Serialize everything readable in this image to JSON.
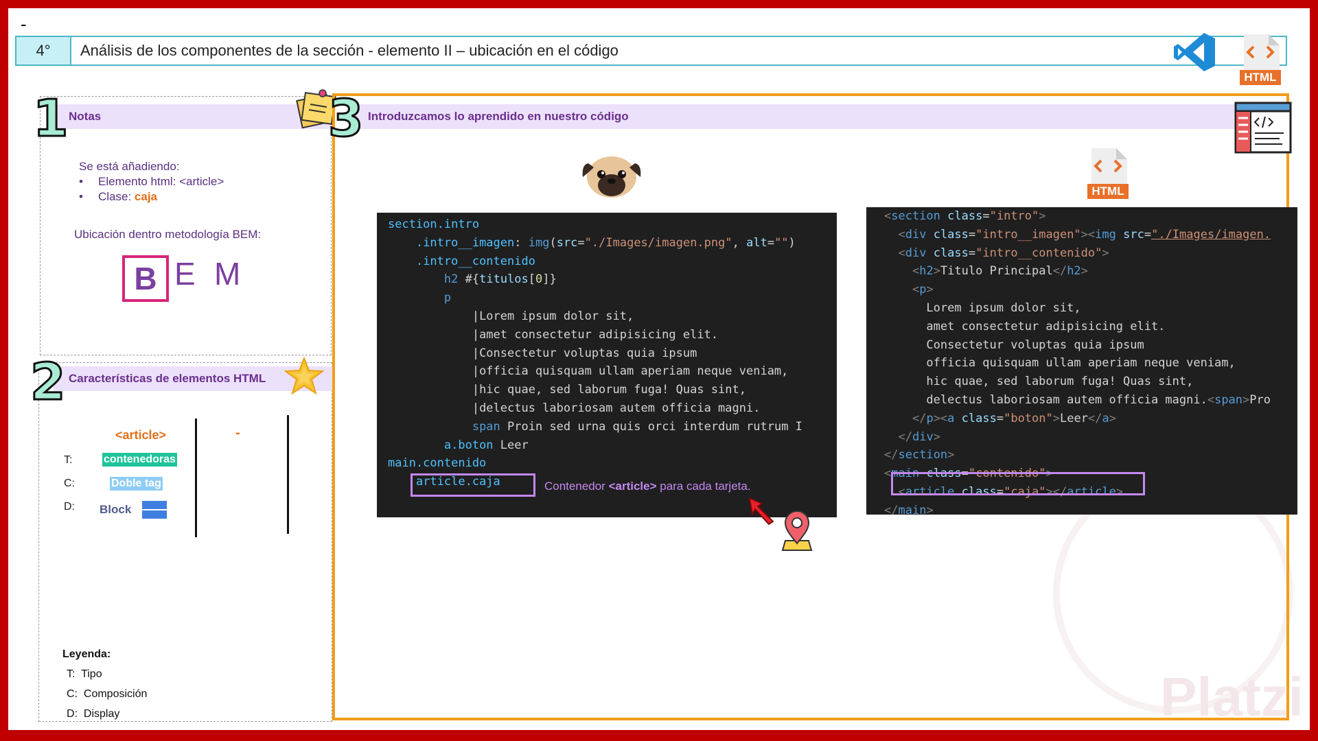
{
  "top_mark": "-",
  "header": {
    "number": "4°",
    "title": "Análisis de los componentes de la sección   - elemento II – ubicación en el código",
    "html_icon_label": "HTML"
  },
  "notes": {
    "step": "1",
    "title": "Notas",
    "intro": "Se está añadiendo:",
    "item1": "Elemento html: <article>",
    "item2_prefix": "Clase: ",
    "item2_value": "caja",
    "bem_label": "Ubicación dentro metodología BEM:",
    "bem_b": "B",
    "bem_e": "E",
    "bem_m": "M"
  },
  "characteristics": {
    "step": "2",
    "title": "Características de elementos HTML",
    "tag": "<article>",
    "other": "-",
    "rows": [
      {
        "key": "T:",
        "value": "contenedoras",
        "color": "#1fc49a"
      },
      {
        "key": "C:",
        "value": "Doble tag",
        "color": "#8ecdf5"
      },
      {
        "key": "D:",
        "value": "Block"
      }
    ],
    "legend_title": "Leyenda:",
    "legend": [
      {
        "key": "T:",
        "value": "Tipo"
      },
      {
        "key": "C:",
        "value": "Composición"
      },
      {
        "key": "D:",
        "value": "Display"
      }
    ]
  },
  "code_panel": {
    "step": "3",
    "title": "Introduzcamos lo aprendido en nuestro código",
    "html_icon_label": "HTML",
    "caption_prefix": "Contenedor ",
    "caption_tag": "<article>",
    "caption_suffix": " para cada tarjeta.",
    "watermark": "Platzi"
  },
  "colors": {
    "frame": "#c00000",
    "header_border": "#4db6c4",
    "code_border": "#f29d1a",
    "band": "#ece1fb",
    "highlight": "#c389f0"
  },
  "icons": [
    "vscode-icon",
    "html-file-icon",
    "sticky-note-icon",
    "star-icon",
    "pug-icon",
    "code-editor-icon",
    "location-pin-icon",
    "cursor-arrow-icon"
  ]
}
